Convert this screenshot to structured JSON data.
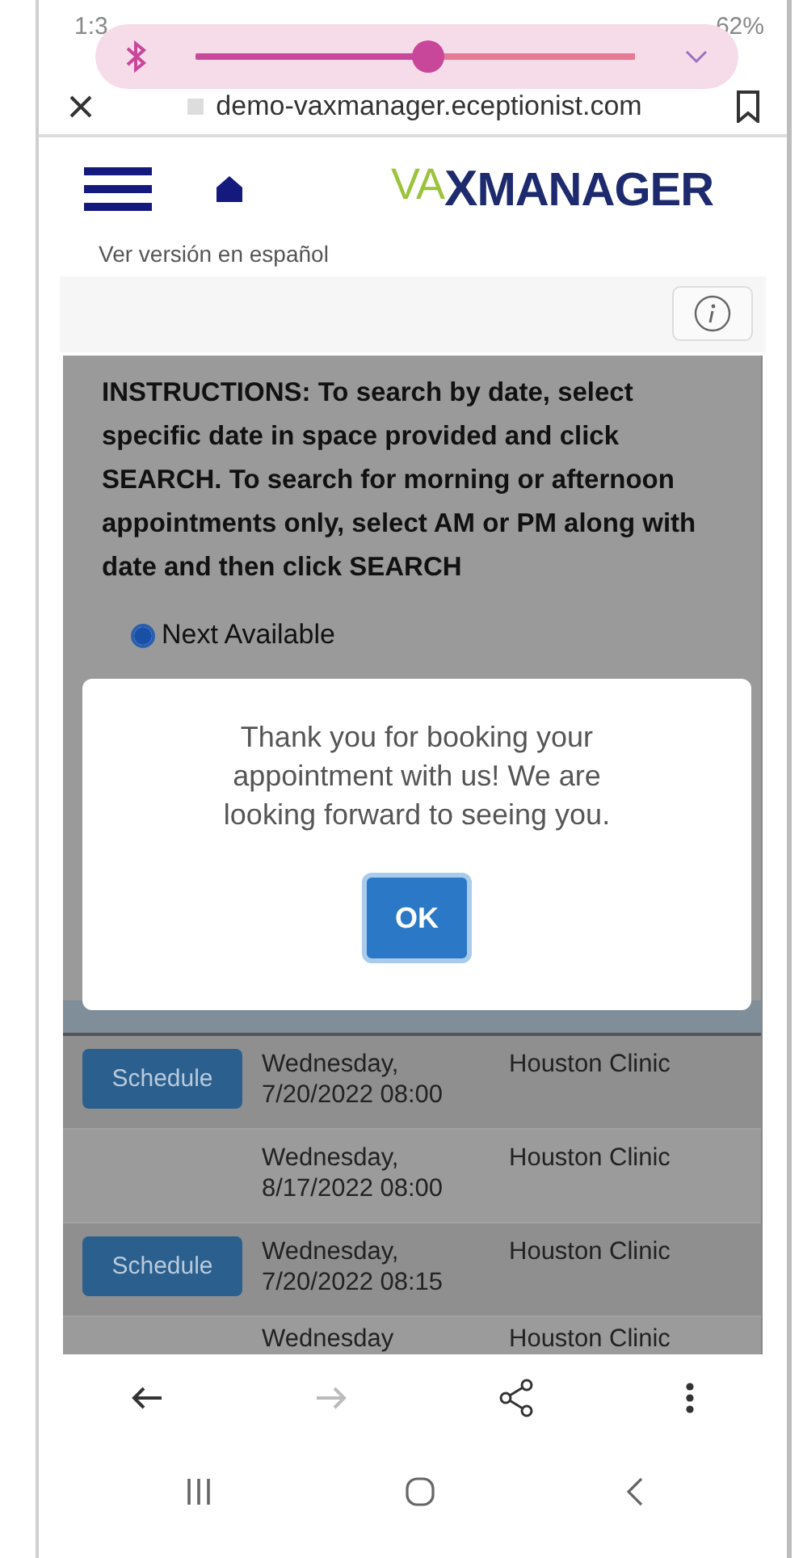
{
  "status_bar": {
    "time": "1:3",
    "battery": "62%"
  },
  "volume_popup": {
    "level": 0.53
  },
  "browser": {
    "url": "demo-vaxmanager.eceptionist.com"
  },
  "logo": {
    "prefix": "VA",
    "mark": "X",
    "name": "MANAGER"
  },
  "language_link": "Ver versión en español",
  "instructions": "INSTRUCTIONS: To search by date, select specific date in space provided and click SEARCH. To search for morning or afternoon appointments only, select AM or PM along with date and then click SEARCH",
  "search_options": [
    {
      "label": "Next Available",
      "selected": true
    }
  ],
  "table": {
    "rows": [
      {
        "action": "Schedule",
        "appt_time": "Wednesday, 7/20/2022 08:00",
        "location": "Houston Clinic"
      },
      {
        "appt_time": "Wednesday, 8/17/2022 08:00",
        "location": "Houston Clinic"
      },
      {
        "action": "Schedule",
        "appt_time": "Wednesday, 7/20/2022 08:15",
        "location": "Houston Clinic"
      },
      {
        "appt_time": "Wednesday",
        "location": "Houston Clinic"
      }
    ]
  },
  "dialog": {
    "message": "Thank you for booking your appointment with us! We are looking forward to seeing you.",
    "button": "OK"
  }
}
